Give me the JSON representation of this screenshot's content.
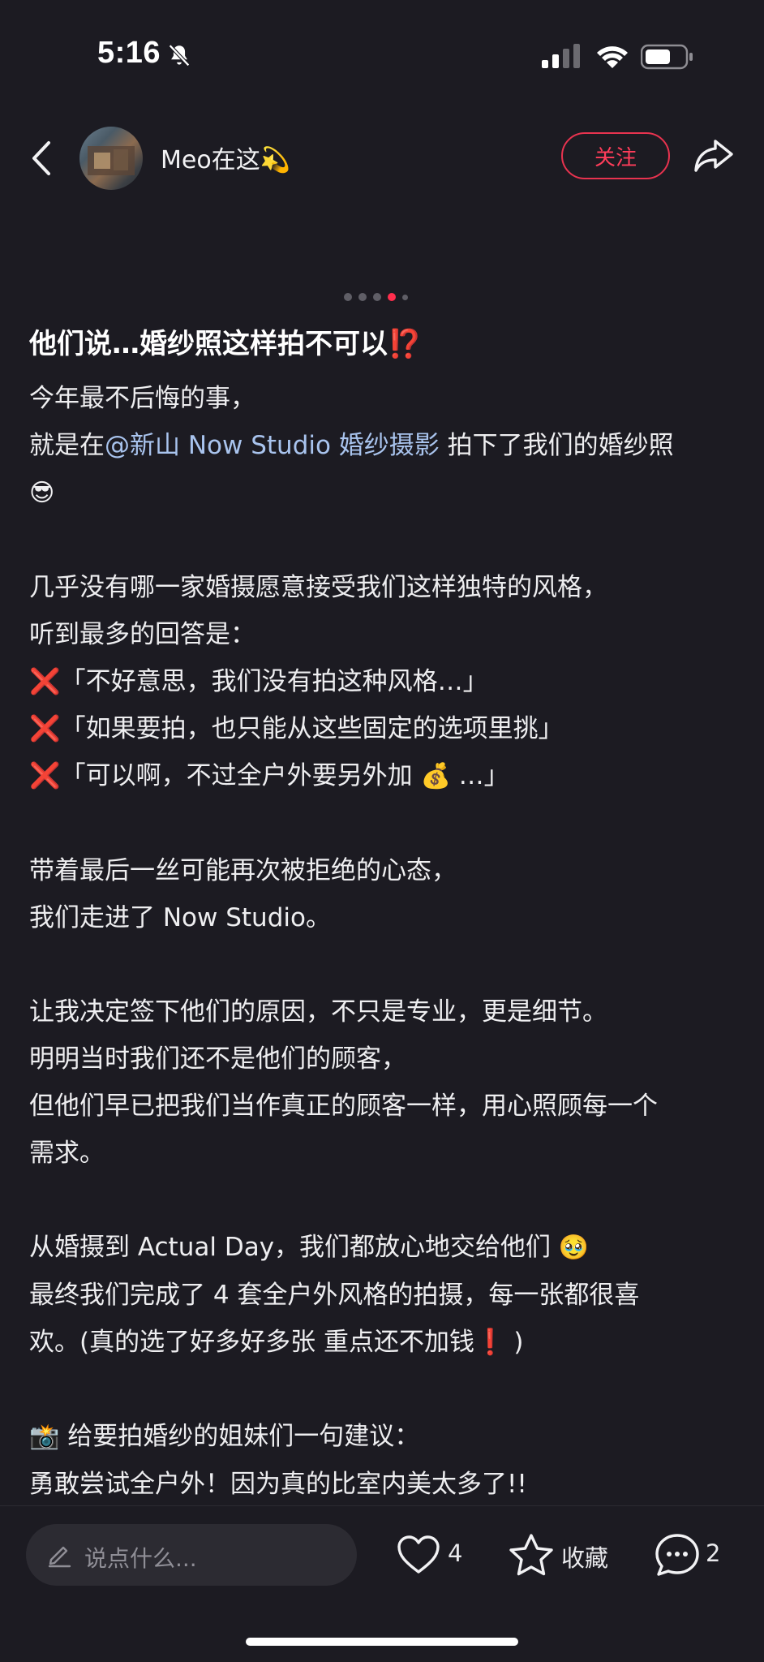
{
  "status_bar": {
    "time": "5:16",
    "icons": [
      "bell-off-icon",
      "signal-icon",
      "wifi-icon",
      "battery-icon"
    ]
  },
  "header": {
    "author_name": "Meo在这💫",
    "follow_label": "关注",
    "icons": [
      "back-icon",
      "share-icon"
    ]
  },
  "carousel": {
    "total": 5,
    "active_index": 3
  },
  "post": {
    "title": "他们说…婚纱照这样拍不可以⁉️",
    "line1": "今年最不后悔的事，",
    "line2_prefix": "就是在",
    "mention": "@新山 Now Studio 婚纱摄影",
    "line2_suffix": " 拍下了我们的婚纱照",
    "emoji_smile": "😎",
    "para2_l1": "几乎没有哪一家婚摄愿意接受我们这样独特的风格，",
    "para2_l2": "听到最多的回答是：",
    "x_mark": "❌",
    "quote1": "「不好意思，我们没有拍这种风格…」",
    "quote2": "「如果要拍，也只能从这些固定的选项里挑」",
    "quote3_prefix": "「可以啊，不过全户外要另外加 ",
    "money_emoji": "💰",
    "quote3_suffix": " …」",
    "para3_l1": "带着最后一丝可能再次被拒绝的心态，",
    "para3_l2": "我们走进了 Now Studio。",
    "para4_l1": "让我决定签下他们的原因，不只是专业，更是细节。",
    "para4_l2": "明明当时我们还不是他们的顾客，",
    "para4_l3": "但他们早已把我们当作真正的顾客一样，用心照顾每一个",
    "para4_l4": "需求。",
    "para5_l1_prefix": "从婚摄到 Actual Day，我们都放心地交给他们 ",
    "teary_emoji": "🥹",
    "para5_l2": "最终我们完成了 4 套全户外风格的拍摄，每一张都很喜",
    "para5_l3_prefix": "欢。(真的选了好多好多张 重点还不加钱",
    "exclaim_emoji": "❗",
    "para5_l3_suffix": " )",
    "camera_emoji": "📸",
    "para6_l1": " 给要拍婚纱的姐妹们一句建议：",
    "para6_l2": "勇敢尝试全户外！因为真的比室内美太多了!!"
  },
  "bottom_bar": {
    "comment_placeholder": "说点什么...",
    "like_count": "4",
    "collect_label": "收藏",
    "comment_count": "2",
    "icons": [
      "pencil-icon",
      "heart-icon",
      "star-icon",
      "comment-bubble-icon"
    ]
  },
  "colors": {
    "background": "#1c1b22",
    "accent": "#ff2e4d",
    "mention": "#a9c4ee"
  }
}
